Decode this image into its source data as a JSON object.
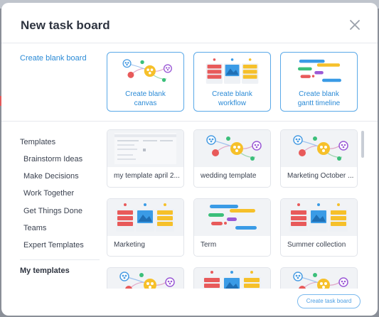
{
  "modal": {
    "title": "New task board",
    "close_icon": "close-icon"
  },
  "create": {
    "label": "Create blank board",
    "cards": [
      {
        "label": "Create blank canvas",
        "icon": "mindmap-thumbnail"
      },
      {
        "label": "Create blank workflow",
        "icon": "workflow-thumbnail"
      },
      {
        "label": "Create blank gantt timeline",
        "icon": "gantt-thumbnail"
      }
    ]
  },
  "sidebar": {
    "heading": "Templates",
    "items": [
      "Brainstorm Ideas",
      "Make Decisions",
      "Work Together",
      "Get Things Done",
      "Teams",
      "Expert Templates"
    ],
    "my_templates": "My templates"
  },
  "templates": [
    {
      "label": "my template april 2...",
      "thumb": "document-thumbnail"
    },
    {
      "label": "wedding template",
      "thumb": "mindmap-thumbnail"
    },
    {
      "label": "Marketing October ...",
      "thumb": "mindmap-thumbnail"
    },
    {
      "label": "Marketing",
      "thumb": "workflow-thumbnail"
    },
    {
      "label": "Term",
      "thumb": "gantt-thumbnail"
    },
    {
      "label": "Summer collection",
      "thumb": "workflow-thumbnail"
    }
  ],
  "footer": {
    "create_button": "Create task board"
  },
  "colors": {
    "accent": "#2a8ad6",
    "red": "#e85a5a",
    "yellow": "#f6c02a",
    "blue": "#3a9be6",
    "green": "#3bbf7a",
    "purple": "#9b59d6"
  }
}
